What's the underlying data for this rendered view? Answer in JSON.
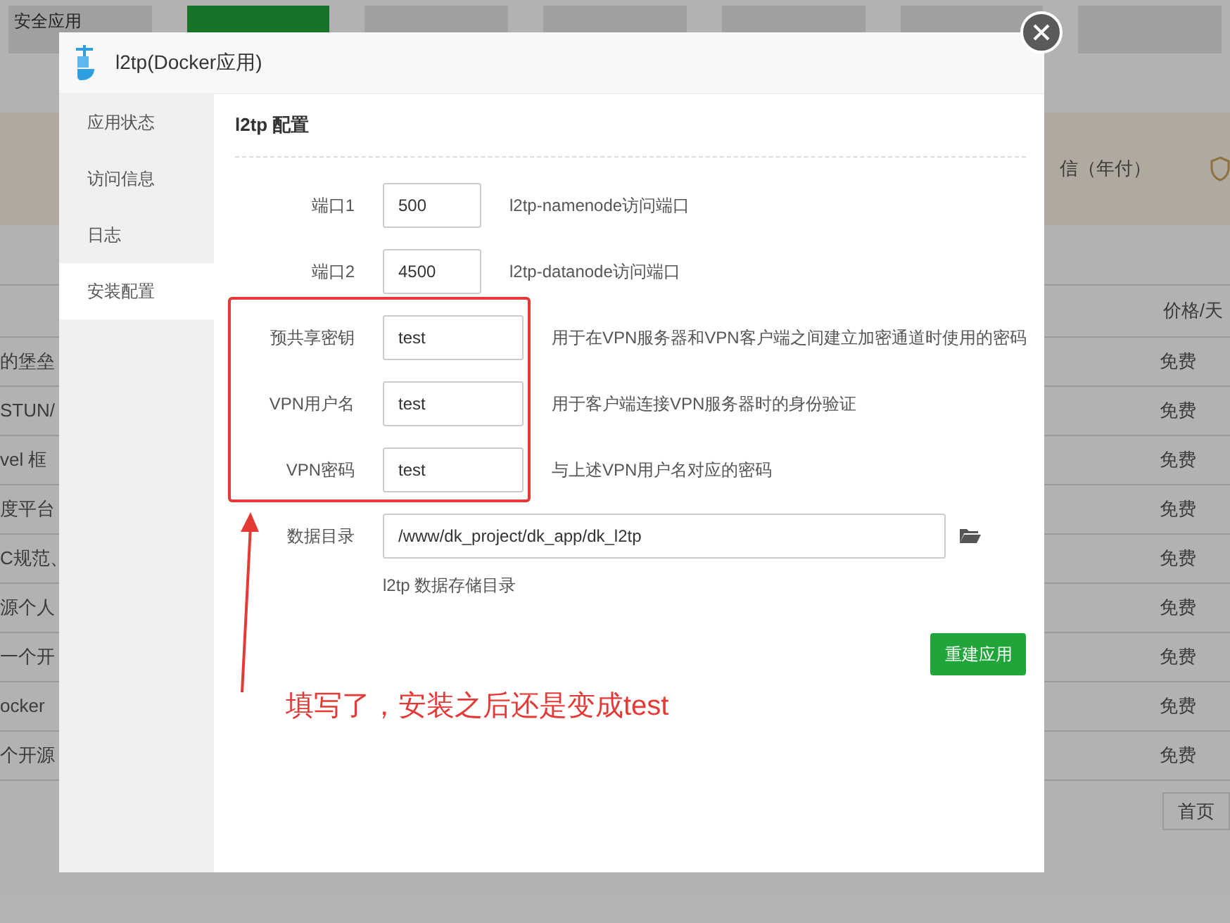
{
  "background": {
    "tabs": [
      {
        "label": "安全应用",
        "selected": false
      },
      {
        "selected": true
      },
      {
        "selected": false
      },
      {
        "selected": false
      },
      {
        "selected": false
      },
      {
        "selected": false
      },
      {
        "selected": false
      }
    ],
    "banner": {
      "text": "信（年付）"
    },
    "table": {
      "price_header": "价格/天",
      "rows": [
        {
          "name": "的堡垒",
          "price": "免费"
        },
        {
          "name": "STUN/",
          "price": "免费"
        },
        {
          "name": "vel 框",
          "price": "免费"
        },
        {
          "name": "度平台",
          "price": "免费"
        },
        {
          "name": "C规范、",
          "price": "免费"
        },
        {
          "name": "源个人",
          "price": "免费"
        },
        {
          "name": "一个开",
          "price": "免费"
        },
        {
          "name": "ocker",
          "price": "免费"
        },
        {
          "name": "个开源",
          "price": "免费"
        }
      ]
    },
    "pager": "首页"
  },
  "dialog": {
    "title": "l2tp(Docker应用)",
    "sidebar": [
      {
        "label": "应用状态",
        "selected": false
      },
      {
        "label": "访问信息",
        "selected": false
      },
      {
        "label": "日志",
        "selected": false
      },
      {
        "label": "安装配置",
        "selected": true
      }
    ],
    "heading": "l2tp 配置",
    "fields": [
      {
        "label": "端口1",
        "value": "500",
        "hint": "l2tp-namenode访问端口",
        "kind": "short"
      },
      {
        "label": "端口2",
        "value": "4500",
        "hint": "l2tp-datanode访问端口",
        "kind": "short"
      },
      {
        "label": "预共享密钥",
        "value": "test",
        "hint": "用于在VPN服务器和VPN客户端之间建立加密通道时使用的密码",
        "kind": "medium"
      },
      {
        "label": "VPN用户名",
        "value": "test",
        "hint": "用于客户端连接VPN服务器时的身份验证",
        "kind": "medium"
      },
      {
        "label": "VPN密码",
        "value": "test",
        "hint": "与上述VPN用户名对应的密码",
        "kind": "medium"
      },
      {
        "label": "数据目录",
        "value": "/www/dk_project/dk_app/dk_l2tp",
        "hint": "l2tp 数据存储目录",
        "kind": "path"
      }
    ],
    "button": "重建应用"
  },
  "annotation": {
    "text": "填写了，安装之后还是变成test"
  }
}
